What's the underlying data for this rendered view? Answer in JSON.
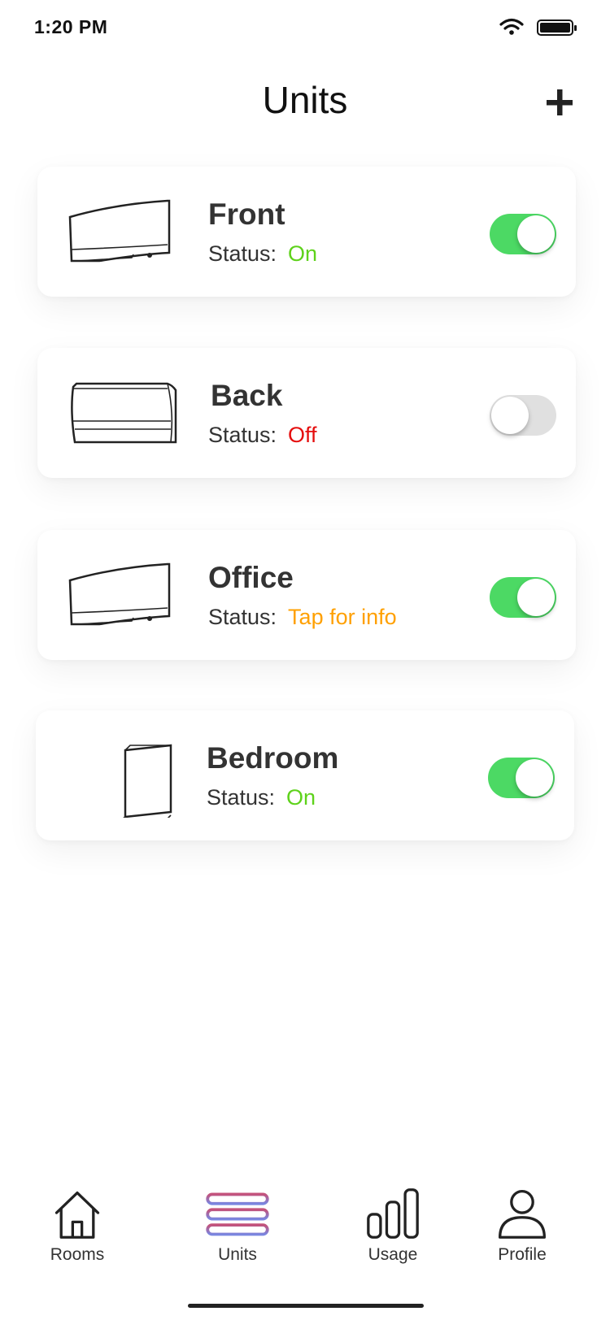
{
  "status_bar": {
    "time": "1:20 PM"
  },
  "header": {
    "title": "Units"
  },
  "units": [
    {
      "name": "Front",
      "status_label": "Status:",
      "status": "On",
      "status_color": "#5ed21b",
      "enabled": true,
      "icon": "wall-ac-curved-icon"
    },
    {
      "name": "Back",
      "status_label": "Status:",
      "status": "Off",
      "status_color": "#e50e0e",
      "enabled": false,
      "icon": "wall-ac-flat-icon"
    },
    {
      "name": "Office",
      "status_label": "Status:",
      "status": "Tap for info",
      "status_color": "#ffa000",
      "enabled": true,
      "icon": "wall-ac-curved-icon"
    },
    {
      "name": "Bedroom",
      "status_label": "Status:",
      "status": "On",
      "status_color": "#5ed21b",
      "enabled": true,
      "icon": "floor-unit-icon"
    }
  ],
  "tabs": [
    {
      "label": "Rooms",
      "icon": "house-icon"
    },
    {
      "label": "Units",
      "icon": "units-stack-icon",
      "active": true,
      "gradient": [
        "#c4527a",
        "#7a86e0"
      ]
    },
    {
      "label": "Usage",
      "icon": "bar-chart-icon"
    },
    {
      "label": "Profile",
      "icon": "person-icon"
    }
  ]
}
